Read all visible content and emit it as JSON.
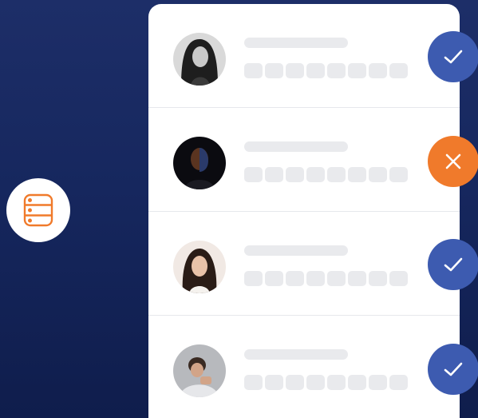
{
  "colors": {
    "background": "#1a2b63",
    "panel": "#ffffff",
    "placeholder": "#e9eaed",
    "approved": "#3d5bb0",
    "rejected": "#f07a2b",
    "database_icon": "#f07a2b"
  },
  "source": {
    "icon": "database-icon"
  },
  "rows": [
    {
      "avatar": "user-avatar-woman",
      "status": "approved",
      "status_icon": "check-icon"
    },
    {
      "avatar": "user-avatar-man",
      "status": "rejected",
      "status_icon": "close-icon"
    },
    {
      "avatar": "user-avatar-woman",
      "status": "approved",
      "status_icon": "check-icon"
    },
    {
      "avatar": "user-avatar-man",
      "status": "approved",
      "status_icon": "check-icon"
    }
  ]
}
